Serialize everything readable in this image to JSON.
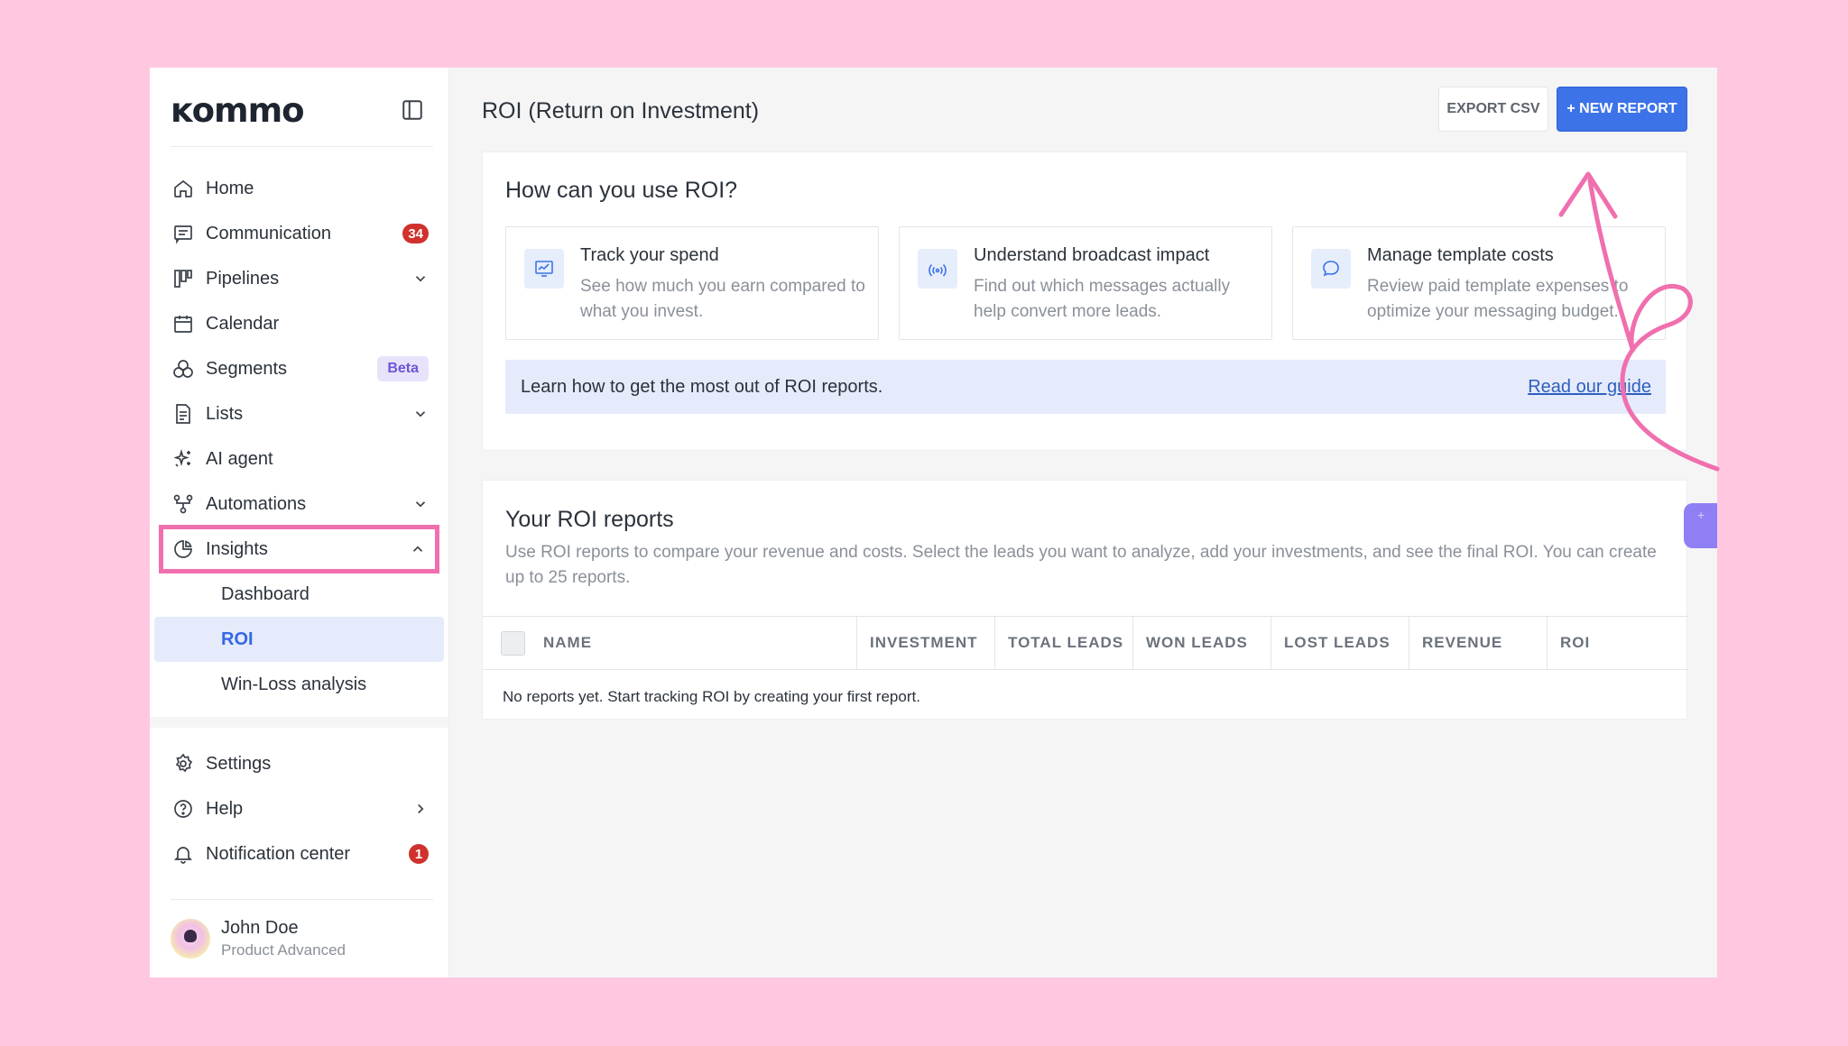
{
  "app": {
    "logo": "ĸommo"
  },
  "sidebar": {
    "items": [
      {
        "label": "Home",
        "icon": "home-icon"
      },
      {
        "label": "Communication",
        "icon": "chat-icon",
        "badge": "34"
      },
      {
        "label": "Pipelines",
        "icon": "pipeline-icon",
        "chevron": "down"
      },
      {
        "label": "Calendar",
        "icon": "calendar-icon"
      },
      {
        "label": "Segments",
        "icon": "segments-icon",
        "badge": "Beta"
      },
      {
        "label": "Lists",
        "icon": "list-icon",
        "chevron": "down"
      },
      {
        "label": "AI agent",
        "icon": "sparkle-icon"
      },
      {
        "label": "Automations",
        "icon": "automation-icon",
        "chevron": "down"
      },
      {
        "label": "Insights",
        "icon": "pie-chart-icon",
        "chevron": "up"
      }
    ],
    "insights_sub": [
      {
        "label": "Dashboard"
      },
      {
        "label": "ROI"
      },
      {
        "label": "Win-Loss analysis"
      }
    ],
    "bottom_items": [
      {
        "label": "Settings",
        "icon": "gear-icon"
      },
      {
        "label": "Help",
        "icon": "help-icon",
        "chevron": "right"
      },
      {
        "label": "Notification center",
        "icon": "bell-icon",
        "badge": "1"
      }
    ],
    "user": {
      "name": "John Doe",
      "plan": "Product Advanced"
    }
  },
  "header": {
    "title": "ROI (Return on Investment)",
    "export_label": "EXPORT CSV",
    "new_report_label": "+ NEW REPORT"
  },
  "how": {
    "title": "How can you use ROI?",
    "tiles": [
      {
        "title": "Track your spend",
        "desc": "See how much you earn compared to what you invest.",
        "icon": "monitor-chart-icon"
      },
      {
        "title": "Understand broadcast impact",
        "desc": "Find out which messages actually help convert more leads.",
        "icon": "broadcast-icon"
      },
      {
        "title": "Manage template costs",
        "desc": "Review paid template expenses to optimize your messaging budget.",
        "icon": "speech-bubble-icon"
      }
    ],
    "guide_text": "Learn how to get the most out of ROI reports.",
    "guide_link": "Read our guide"
  },
  "reports": {
    "title": "Your ROI reports",
    "desc": "Use ROI reports to compare your revenue and costs. Select the leads you want to analyze, add your investments, and see the final ROI. You can create up to 25 reports.",
    "columns": [
      "NAME",
      "INVESTMENT",
      "TOTAL LEADS",
      "WON LEADS",
      "LOST LEADS",
      "REVENUE",
      "ROI"
    ],
    "empty": "No reports yet. Start tracking ROI by creating your first report."
  },
  "colors": {
    "background": "#ffc8e0",
    "accent": "#3d73e8",
    "annotation": "#f06fae",
    "badge": "#d0312d"
  }
}
